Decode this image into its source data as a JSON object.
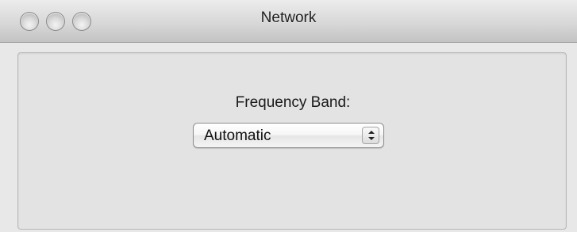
{
  "window": {
    "title": "Network",
    "buttons": [
      "close",
      "minimize",
      "zoom"
    ]
  },
  "settings": {
    "frequency_band_label": "Frequency Band:",
    "frequency_band_value": "Automatic"
  },
  "icons": {
    "popup_arrows": "up-down-chevron-icon"
  }
}
